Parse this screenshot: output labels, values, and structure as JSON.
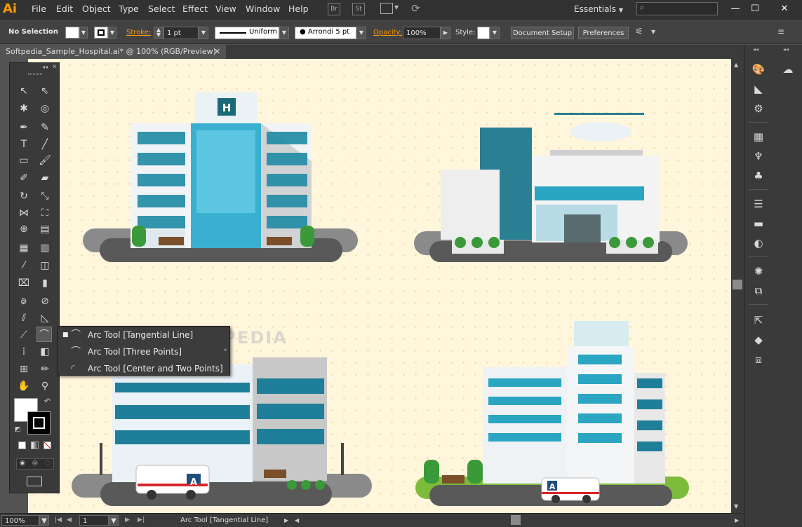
{
  "app": {
    "logo": "Ai",
    "workspace": "Essentials"
  },
  "menu": [
    "File",
    "Edit",
    "Object",
    "Type",
    "Select",
    "Effect",
    "View",
    "Window",
    "Help"
  ],
  "toolbar_icons": [
    "Br",
    "St"
  ],
  "control": {
    "selection": "No Selection",
    "stroke_label": "Stroke:",
    "stroke_value": "1 pt",
    "profile": "Uniform",
    "brush": "Arrondi 5 pt",
    "opacity_label": "Opacity:",
    "opacity_value": "100%",
    "style_label": "Style:",
    "document_setup": "Document Setup",
    "preferences": "Preferences"
  },
  "document": {
    "tab_title": "Softpedia_Sample_Hospital.ai* @ 100% (RGB/Preview)",
    "close": "✕"
  },
  "flyout": {
    "items": [
      "Arc Tool [Tangential Line]",
      "Arc Tool [Three Points]",
      "Arc Tool [Center and Two Points]"
    ]
  },
  "status": {
    "zoom": "100%",
    "artboard": "1",
    "tool": "Arc Tool [Tangential Line]"
  },
  "watermark": "SOFTPEDIA",
  "artwork": {
    "hospital_sign": "H",
    "ambulance_letter": "A"
  },
  "colors": {
    "accent": "#ff9a00",
    "teal": "#1f8fa6",
    "canvas": "#fff6dc"
  }
}
